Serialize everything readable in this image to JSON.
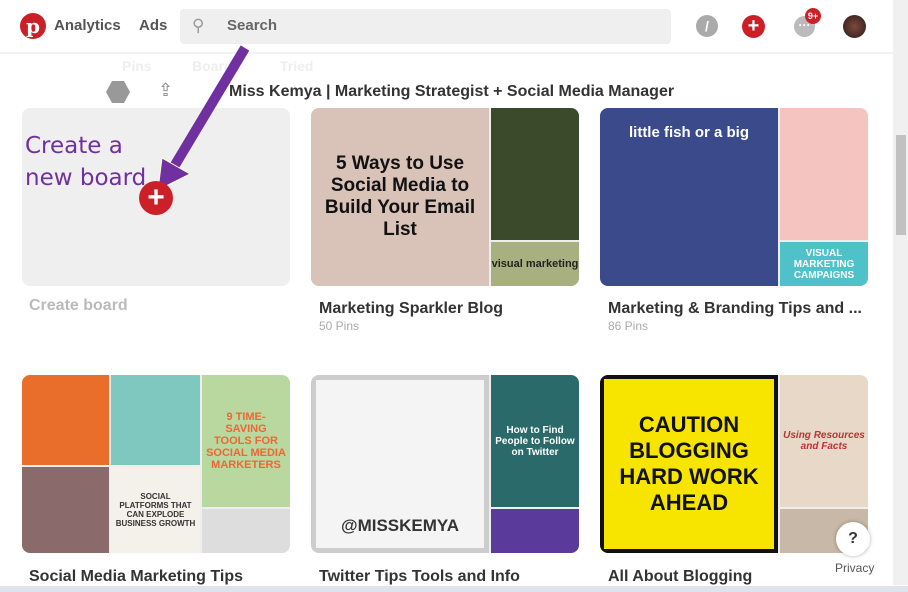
{
  "header": {
    "nav": [
      "Analytics",
      "Ads"
    ],
    "search_placeholder": "Search",
    "notification_badge": "9+"
  },
  "profile": {
    "tabs": [
      "Pins",
      "Boards",
      "Tried"
    ],
    "name": "Miss Kemya | Marketing Strategist + Social Media Manager"
  },
  "annotation": {
    "line1": "Create a",
    "line2": "new board"
  },
  "create_board": {
    "label": "Create board"
  },
  "boards": [
    {
      "title": "Marketing Sparkler Blog",
      "pins": "50 Pins",
      "cover_text": "5 Ways to Use Social Media to Build Your Email List",
      "side_text": "visual marketing",
      "colors": [
        "#d9c3b8",
        "#3a4a2a",
        "#a8b080"
      ]
    },
    {
      "title": "Marketing & Branding Tips and ...",
      "pins": "86 Pins",
      "cover_text": "little fish or a big",
      "side_text": "VISUAL MARKETING CAMPAIGNS",
      "colors": [
        "#3a4a8a",
        "#e45a5a",
        "#4fc1c8"
      ]
    },
    {
      "title": "Social Media Marketing Tips",
      "pins": "",
      "cover_text": "SOCIAL PLATFORMS THAT CAN EXPLODE BUSINESS GROWTH",
      "side_text": "9 TIME-SAVING TOOLS FOR SOCIAL MEDIA MARKETERS",
      "colors": [
        "#e96e2c",
        "#7fc8c0",
        "#b8d8a0"
      ]
    },
    {
      "title": "Twitter Tips Tools and Info",
      "pins": "",
      "cover_text": "@MISSKEMYA",
      "side_text": "How to Find People to Follow on Twitter",
      "colors": [
        "#f4f4f4",
        "#2a6a6a",
        "#5a3a9a"
      ]
    },
    {
      "title": "All About Blogging",
      "pins": "",
      "cover_text": "CAUTION BLOGGING HARD WORK AHEAD",
      "side_text": "Using Resources and Facts",
      "colors": [
        "#f7e500",
        "#e8d8c8",
        "#c8b8a8"
      ]
    }
  ],
  "help": {
    "label": "?",
    "privacy": "Privacy"
  },
  "colors": {
    "brand": "#cb2027",
    "annotation": "#7030a0"
  }
}
